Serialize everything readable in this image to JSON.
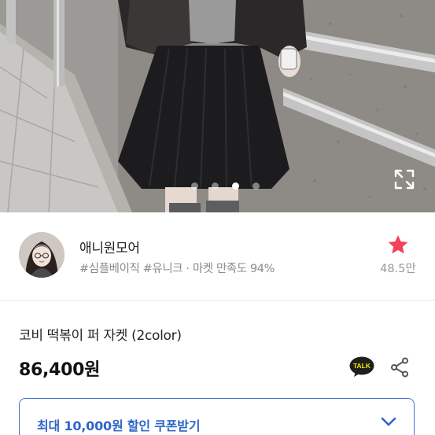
{
  "gallery": {
    "total_images": 4,
    "active_index": 3
  },
  "shop": {
    "name": "애니원모어",
    "subtitle": "#심플베이직 #유니크 · 마켓 만족도 94%",
    "favorite_count": "48.5만"
  },
  "product": {
    "title": "코비 떡볶이 퍼 자켓 (2color)",
    "price": "86,400원",
    "talk_label": "TALK"
  },
  "coupon": {
    "label": "최대 10,000원 할인 쿠폰받기"
  },
  "colors": {
    "favorite_star": "#f2415a",
    "coupon_accent": "#2f65c8",
    "talk_badge": "#1e1e1e"
  },
  "icons": {
    "expand": "expand-icon",
    "favorite": "star-icon",
    "talk": "kakao-talk-icon",
    "share": "share-icon",
    "coupon_toggle": "chevron-down-icon"
  }
}
